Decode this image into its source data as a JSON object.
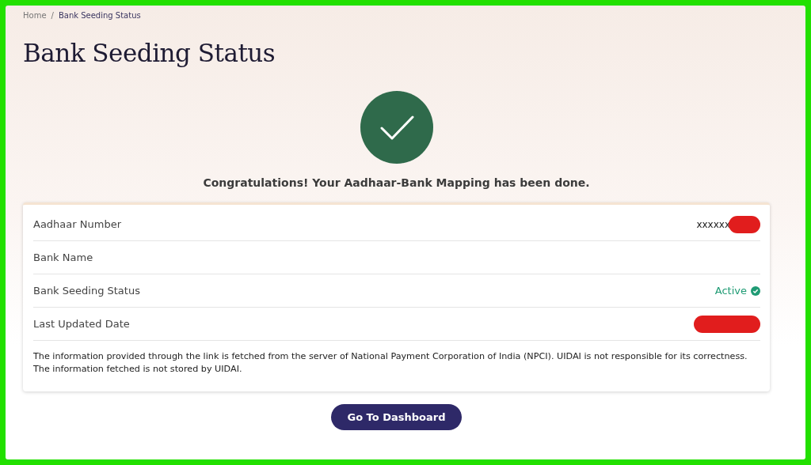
{
  "breadcrumb": [
    {
      "label": "Home",
      "current": false
    },
    {
      "label": "Bank Seeding Status",
      "current": true
    }
  ],
  "breadcrumb_separator": "/",
  "title": "Bank Seeding Status",
  "success_message": "Congratulations! Your Aadhaar-Bank Mapping has been done.",
  "details": [
    {
      "label": "Aadhaar Number",
      "kind": "text",
      "value": "xxxxxx",
      "redacted": true
    },
    {
      "label": "Bank Name",
      "kind": "text"
    },
    {
      "label": "Bank Seeding Status",
      "kind": "status",
      "value": "Active"
    },
    {
      "label": "Last Updated Date",
      "kind": "text",
      "redacted": true
    }
  ],
  "disclaimer": "The information provided through the link is fetched from the server of National Payment Corporation of India (NPCI). UIDAI is not responsible for its correctness. The information fetched is not stored by UIDAI.",
  "button": "Go To Dashboard"
}
